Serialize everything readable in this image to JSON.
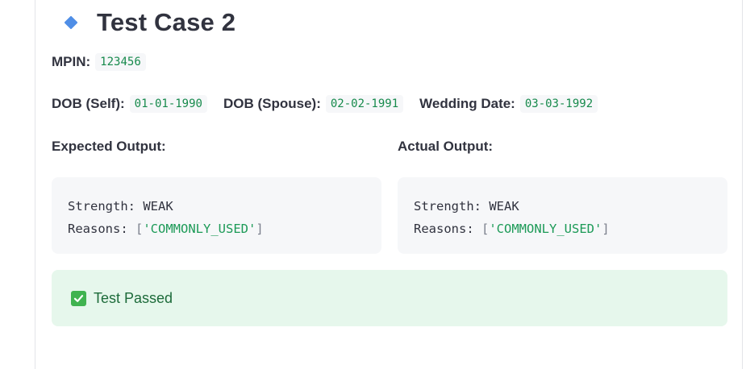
{
  "test_case": {
    "title": "Test Case 2",
    "icon": "diamond-icon",
    "accent_color": "#4f8ee6"
  },
  "inputs": {
    "mpin_label": "MPIN:",
    "mpin_value": "123456",
    "dob_self_label": "DOB (Self):",
    "dob_self_value": "01-01-1990",
    "dob_spouse_label": "DOB (Spouse):",
    "dob_spouse_value": "02-02-1991",
    "wedding_label": "Wedding Date:",
    "wedding_value": "03-03-1992"
  },
  "expected": {
    "label": "Expected Output:",
    "strength_key": "Strength:",
    "strength_value": "WEAK",
    "reasons_key": "Reasons:",
    "reasons_value": "'COMMONLY_USED'"
  },
  "actual": {
    "label": "Actual Output:",
    "strength_key": "Strength:",
    "strength_value": "WEAK",
    "reasons_key": "Reasons:",
    "reasons_value": "'COMMONLY_USED'"
  },
  "result": {
    "text": "Test Passed",
    "icon": "check-box-icon",
    "status_color": "#3fb34f"
  }
}
